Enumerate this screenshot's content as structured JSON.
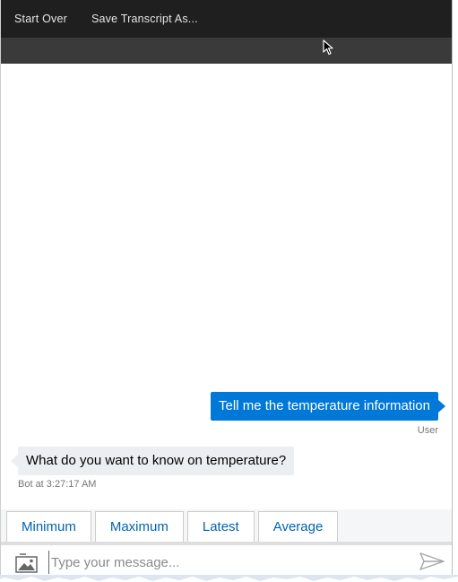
{
  "menubar": {
    "items": [
      "Start Over",
      "Save Transcript As..."
    ]
  },
  "messages": {
    "user_text": "Tell me the temperature information",
    "user_meta": "User",
    "bot_text": "What do you want to know on temperature?",
    "bot_meta": "Bot at 3:27:17 AM"
  },
  "suggested_actions": [
    "Minimum",
    "Maximum",
    "Latest",
    "Average"
  ],
  "composer": {
    "placeholder": "Type your message...",
    "upload_icon": "image-icon",
    "send_icon": "send-icon"
  },
  "colors": {
    "menubar": "#1f1f1f",
    "toolbar": "#3a3a3a",
    "user_bubble": "#0078d7",
    "bot_bubble": "#eceff1",
    "action_text": "#0063b1"
  }
}
